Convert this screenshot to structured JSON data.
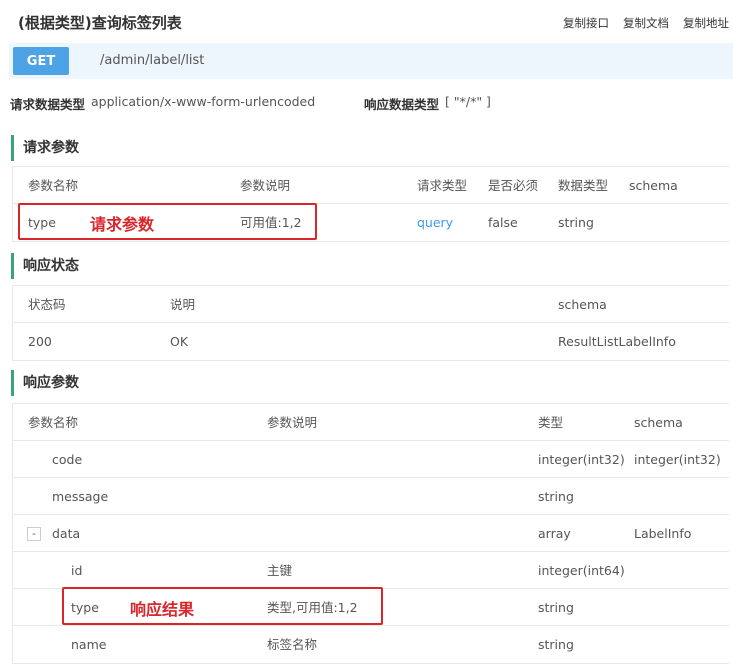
{
  "title": "(根据类型)查询标签列表",
  "copy": [
    "复制接口",
    "复制文档",
    "复制地址"
  ],
  "method": "GET",
  "path": "/admin/label/list",
  "meta": {
    "req_type_label": "请求数据类型",
    "req_type_value": "application/x-www-form-urlencoded",
    "resp_type_label": "响应数据类型",
    "resp_type_value": "[ \"*/*\" ]"
  },
  "request": {
    "title": "请求参数",
    "headers": [
      "参数名称",
      "参数说明",
      "请求类型",
      "是否必须",
      "数据类型",
      "schema"
    ],
    "rows": [
      {
        "name": "type",
        "desc": "可用值:1,2",
        "in": "query",
        "required": "false",
        "dtype": "string",
        "schema": ""
      }
    ],
    "annotation": "请求参数"
  },
  "status": {
    "title": "响应状态",
    "headers": [
      "状态码",
      "说明",
      "schema"
    ],
    "rows": [
      {
        "code": "200",
        "desc": "OK",
        "schema": "ResultListLabelInfo"
      }
    ]
  },
  "response": {
    "title": "响应参数",
    "headers": [
      "参数名称",
      "参数说明",
      "类型",
      "schema"
    ],
    "rows": [
      {
        "name": "code",
        "desc": "",
        "type": "integer(int32)",
        "schema": "integer(int32)"
      },
      {
        "name": "message",
        "desc": "",
        "type": "string",
        "schema": ""
      },
      {
        "name": "data",
        "desc": "",
        "type": "array",
        "schema": "LabelInfo",
        "toggle": "-"
      },
      {
        "name": "id",
        "desc": "主键",
        "type": "integer(int64)",
        "schema": ""
      },
      {
        "name": "type",
        "desc": "类型,可用值:1,2",
        "type": "string",
        "schema": ""
      },
      {
        "name": "name",
        "desc": "标签名称",
        "type": "string",
        "schema": ""
      }
    ],
    "annotation": "响应结果"
  }
}
